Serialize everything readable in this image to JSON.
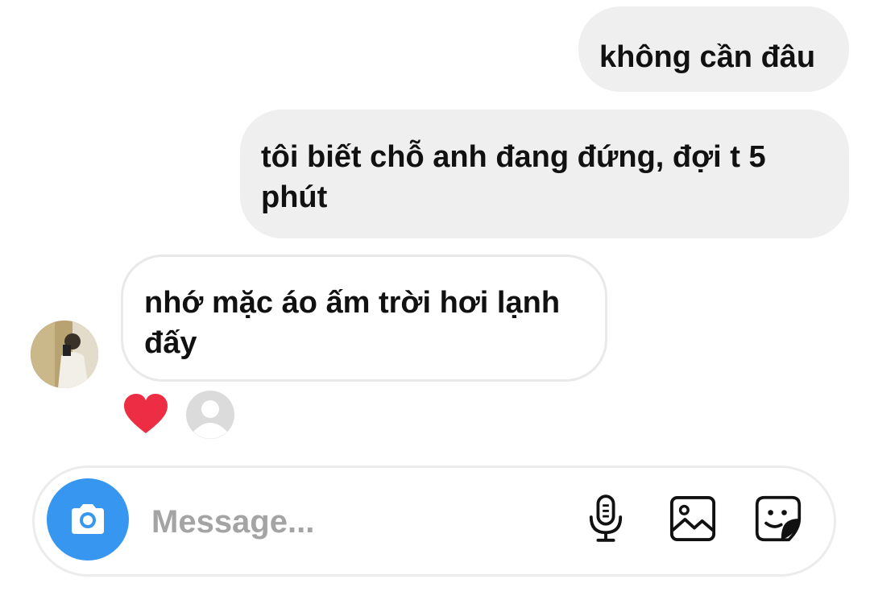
{
  "messages": [
    {
      "direction": "outgoing",
      "text": "không cần đâu"
    },
    {
      "direction": "outgoing",
      "text": "tôi biết chỗ anh đang đứng, đợi t 5 phút"
    },
    {
      "direction": "incoming",
      "text": "nhớ mặc áo ấm trời hơi lạnh đấy"
    }
  ],
  "reactions": {
    "emoji": "heart",
    "color": "#ed2d44"
  },
  "composer": {
    "placeholder": "Message...",
    "accent": "#3797f0",
    "icons": [
      "camera-icon",
      "microphone-icon",
      "gallery-icon",
      "sticker-icon"
    ]
  }
}
